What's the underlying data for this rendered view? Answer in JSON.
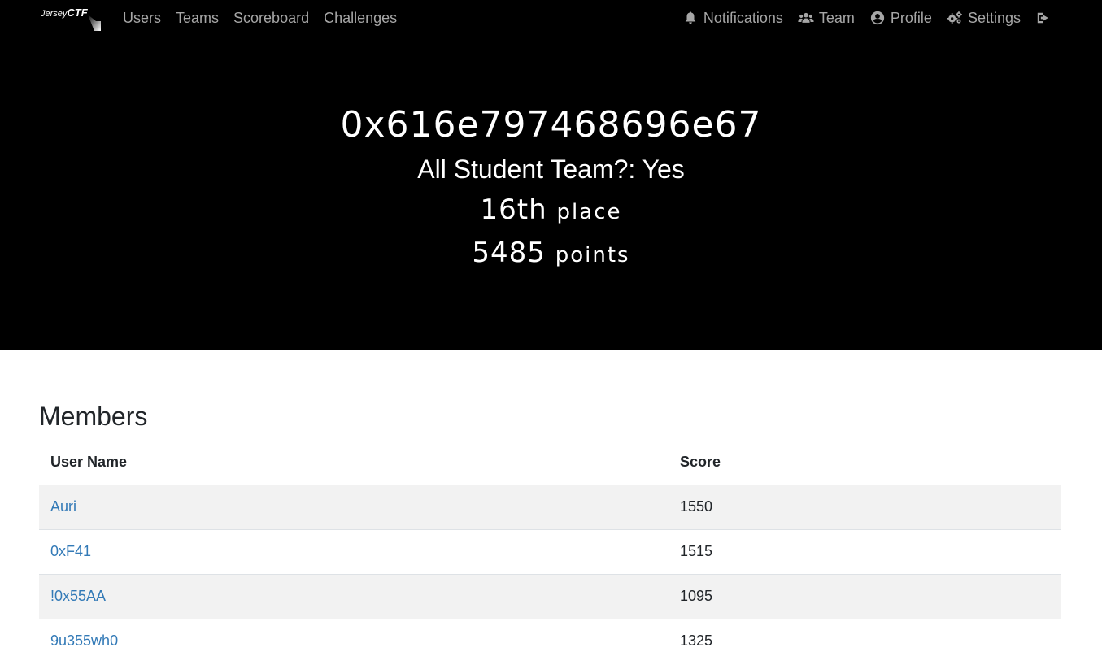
{
  "navbar": {
    "brand": {
      "prefix": "Jersey",
      "suffix": "CTF"
    },
    "left_links": [
      {
        "label": "Users"
      },
      {
        "label": "Teams"
      },
      {
        "label": "Scoreboard"
      },
      {
        "label": "Challenges"
      }
    ],
    "right_links": [
      {
        "label": "Notifications",
        "icon": "bell-icon"
      },
      {
        "label": "Team",
        "icon": "users-icon"
      },
      {
        "label": "Profile",
        "icon": "user-circle-icon"
      },
      {
        "label": "Settings",
        "icon": "cogs-icon"
      },
      {
        "label": "",
        "icon": "logout-icon"
      }
    ]
  },
  "team": {
    "name": "0x616e797468696e67",
    "student_label": "All Student Team?: Yes",
    "place_value": "16th",
    "place_word": "place",
    "points_value": "5485",
    "points_word": "points"
  },
  "members": {
    "title": "Members",
    "headers": {
      "user": "User Name",
      "score": "Score"
    },
    "rows": [
      {
        "user": "Auri",
        "score": "1550"
      },
      {
        "user": "0xF41",
        "score": "1515"
      },
      {
        "user": "!0x55AA",
        "score": "1095"
      },
      {
        "user": "9u355wh0",
        "score": "1325"
      }
    ]
  },
  "colors": {
    "navbar_bg": "#000000",
    "link": "#337ab7",
    "nav_text": "#a6a6a6",
    "stripe": "#f2f2f2"
  }
}
